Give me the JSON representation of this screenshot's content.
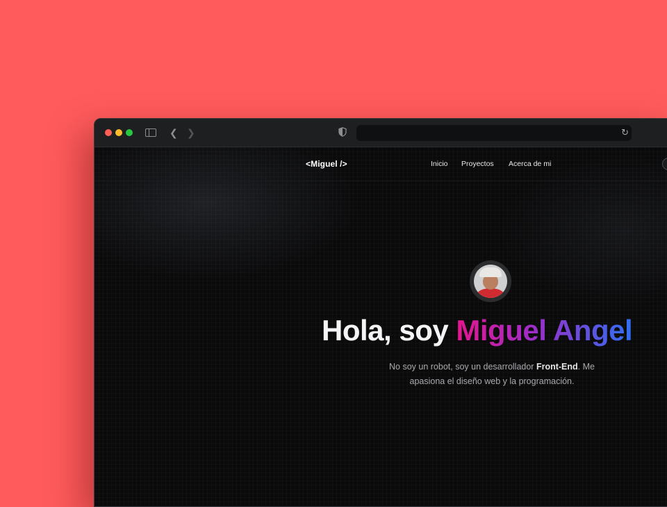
{
  "browser": {
    "address_value": "",
    "icons": [
      "sidebar-icon",
      "back-icon",
      "forward-icon",
      "shield-icon",
      "reload-icon"
    ]
  },
  "site": {
    "logo": "<Miguel />",
    "nav": [
      {
        "label": "Inicio"
      },
      {
        "label": "Proyectos"
      },
      {
        "label": "Acerca de mi"
      }
    ]
  },
  "hero": {
    "greeting": "Hola, soy ",
    "name": "Miguel Angel",
    "subtitle_before": "No soy un robot, soy un desarrollador ",
    "subtitle_strong": "Front-End",
    "subtitle_after": ". Me apasiona el diseño web y la programación."
  },
  "colors": {
    "background": "#ff5b5c",
    "page_bg": "#0a0a0b",
    "gradient_start": "#e6158e",
    "gradient_mid": "#9b2fc9",
    "gradient_end": "#2f6ff2"
  }
}
